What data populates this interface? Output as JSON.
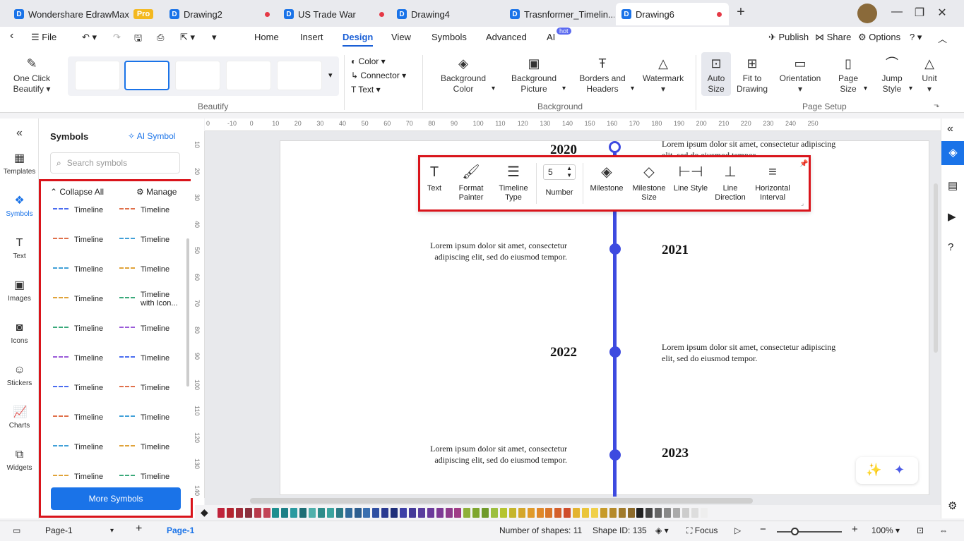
{
  "tabs": [
    {
      "label": "Wondershare EdrawMax",
      "badge": "Pro"
    },
    {
      "label": "Drawing2",
      "unsaved": true
    },
    {
      "label": "US Trade War",
      "unsaved": true
    },
    {
      "label": "Drawing4"
    },
    {
      "label": "Trasnformer_Timelin...",
      "unsaved": false
    },
    {
      "label": "Drawing6",
      "unsaved": true
    }
  ],
  "menubar": {
    "file": "File",
    "items": [
      "Home",
      "Insert",
      "Design",
      "View",
      "Symbols",
      "Advanced",
      "AI"
    ],
    "active": "Design",
    "ai_badge": "hot",
    "publish": "Publish",
    "share": "Share",
    "options": "Options"
  },
  "ribbon": {
    "one_click_beautify": [
      "One Click",
      "Beautify"
    ],
    "beautify_group": "Beautify",
    "color": "Color",
    "connector": "Connector",
    "text": "Text",
    "background_color": [
      "Background",
      "Color"
    ],
    "background_picture": [
      "Background",
      "Picture"
    ],
    "borders_headers": [
      "Borders and",
      "Headers"
    ],
    "watermark": "Watermark",
    "background_group": "Background",
    "auto_size": [
      "Auto",
      "Size"
    ],
    "fit_to_drawing": [
      "Fit to",
      "Drawing"
    ],
    "orientation": "Orientation",
    "page_size": [
      "Page",
      "Size"
    ],
    "jump_style": [
      "Jump",
      "Style"
    ],
    "unit": "Unit",
    "page_setup_group": "Page Setup"
  },
  "leftbar": [
    "Templates",
    "Symbols",
    "Text",
    "Images",
    "Icons",
    "Stickers",
    "Charts",
    "Widgets"
  ],
  "symbols_panel": {
    "title": "Symbols",
    "ai_symbol": "AI Symbol",
    "search_placeholder": "Search symbols",
    "collapse_all": "Collapse All",
    "manage": "Manage",
    "items": [
      [
        "Timeline",
        "Timeline"
      ],
      [
        "Timeline",
        "Timeline"
      ],
      [
        "Timeline",
        "Timeline"
      ],
      [
        "Timeline",
        "Timeline with Icon..."
      ],
      [
        "Timeline",
        "Timeline"
      ],
      [
        "Timeline",
        "Timeline"
      ],
      [
        "Timeline",
        "Timeline"
      ],
      [
        "Timeline",
        "Timeline"
      ],
      [
        "Timeline",
        "Timeline"
      ],
      [
        "Timeline",
        "Timeline"
      ]
    ],
    "more_symbols": "More Symbols"
  },
  "ruler_top": [
    "0",
    "-10",
    "0",
    "10",
    "20",
    "30",
    "40",
    "50",
    "60",
    "70",
    "80",
    "90",
    "100",
    "110",
    "120",
    "130",
    "140",
    "150",
    "160",
    "170",
    "180",
    "190",
    "200",
    "210",
    "220",
    "230",
    "240",
    "250"
  ],
  "ruler_left": [
    "10",
    "20",
    "30",
    "40",
    "50",
    "60",
    "70",
    "80",
    "90",
    "100",
    "110",
    "120",
    "130",
    "140"
  ],
  "timeline": {
    "entries": [
      {
        "year": "2020",
        "text": "Lorem ipsum dolor sit amet, consectetur adipiscing elit, sed do eiusmod tempor."
      },
      {
        "year": "2021",
        "text": "Lorem ipsum dolor sit amet, consectetur adipiscing elit, sed do eiusmod tempor."
      },
      {
        "year": "2022",
        "text": "Lorem ipsum dolor sit amet, consectetur adipiscing elit, sed do eiusmod tempor."
      },
      {
        "year": "2023",
        "text": "Lorem ipsum dolor sit amet, consectetur adipiscing elit, sed do eiusmod tempor."
      }
    ],
    "line_color": "#3d4ae0"
  },
  "floating_toolbar": {
    "text": "Text",
    "format_painter": [
      "Format",
      "Painter"
    ],
    "timeline_type": [
      "Timeline",
      "Type"
    ],
    "number_value": "5",
    "number": "Number",
    "milestone": "Milestone",
    "milestone_size": [
      "Milestone",
      "Size"
    ],
    "line_style": "Line Style",
    "line_direction": [
      "Line",
      "Direction"
    ],
    "horizontal_interval": [
      "Horizontal",
      "Interval"
    ]
  },
  "palette": [
    "#c0233b",
    "#b4242f",
    "#a12c3a",
    "#8a2f3c",
    "#b83a4b",
    "#c24356",
    "#1e8f8f",
    "#1c7f86",
    "#2a9aa0",
    "#1d6e75",
    "#4fb0ab",
    "#2d8c8a",
    "#3aa39e",
    "#2c7a85",
    "#316a9a",
    "#2d5e8f",
    "#3a6fb0",
    "#2f4fa2",
    "#2a3a91",
    "#1f2f7a",
    "#3c3fa6",
    "#443a99",
    "#5a3e9e",
    "#6b3a9b",
    "#7e3a95",
    "#8f3b8c",
    "#a03c86",
    "#8fb03a",
    "#7ea62e",
    "#6f9a2a",
    "#9cbf3f",
    "#b5c42f",
    "#c5b52b",
    "#d4a62a",
    "#e09a2a",
    "#e0882a",
    "#d9762b",
    "#d4602b",
    "#cf4d2b",
    "#e3b32f",
    "#eac53a",
    "#f0d04a",
    "#c79b2a",
    "#b58a2a",
    "#a07a2a",
    "#8c6a2a",
    "#222222",
    "#444444",
    "#666666",
    "#888888",
    "#aaaaaa",
    "#cccccc",
    "#dddddd",
    "#eeeeee"
  ],
  "status": {
    "page_tab": "Page-1",
    "page_active": "Page-1",
    "shapes": "Number of shapes: 11",
    "shape_id": "Shape ID: 135",
    "focus": "Focus",
    "zoom": "100%"
  }
}
